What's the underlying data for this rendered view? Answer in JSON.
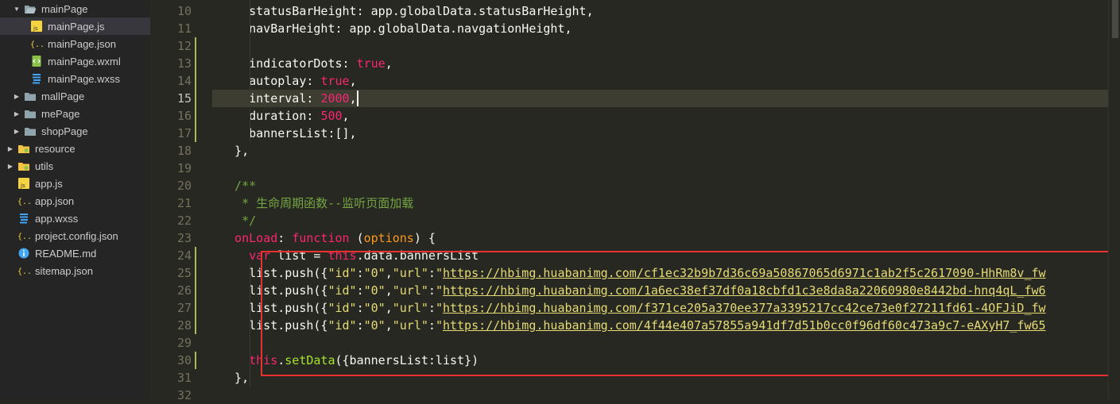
{
  "sidebar": {
    "items": [
      {
        "label": "mainPage",
        "type": "folder",
        "open": true,
        "indent": 0
      },
      {
        "label": "mainPage.js",
        "type": "js",
        "indent": 1,
        "selected": true
      },
      {
        "label": "mainPage.json",
        "type": "json",
        "indent": 1
      },
      {
        "label": "mainPage.wxml",
        "type": "wxml",
        "indent": 1
      },
      {
        "label": "mainPage.wxss",
        "type": "wxss",
        "indent": 1
      },
      {
        "label": "mallPage",
        "type": "folder",
        "open": false,
        "indent": 0
      },
      {
        "label": "mePage",
        "type": "folder",
        "open": false,
        "indent": 0
      },
      {
        "label": "shopPage",
        "type": "folder",
        "open": false,
        "indent": 0
      },
      {
        "label": "resource",
        "type": "folder-special",
        "open": false,
        "indent": -1
      },
      {
        "label": "utils",
        "type": "folder-special",
        "open": false,
        "indent": -1
      },
      {
        "label": "app.js",
        "type": "js",
        "indent": -1
      },
      {
        "label": "app.json",
        "type": "json",
        "indent": -1
      },
      {
        "label": "app.wxss",
        "type": "wxss",
        "indent": -1
      },
      {
        "label": "project.config.json",
        "type": "json",
        "indent": -1
      },
      {
        "label": "README.md",
        "type": "info",
        "indent": -1
      },
      {
        "label": "sitemap.json",
        "type": "json",
        "indent": -1
      }
    ]
  },
  "editor": {
    "line_numbers": [
      "10",
      "11",
      "12",
      "13",
      "14",
      "15",
      "16",
      "17",
      "18",
      "19",
      "20",
      "21",
      "22",
      "23",
      "24",
      "25",
      "26",
      "27",
      "28",
      "29",
      "30",
      "31",
      "32"
    ],
    "current_line": "15",
    "lines": [
      {
        "n": "10",
        "tokens": [
          {
            "c": "t",
            "v": "    statusBarHeight: app.globalData.statusBarHeight,"
          }
        ]
      },
      {
        "n": "11",
        "tokens": [
          {
            "c": "t",
            "v": "    navBarHeight: app.globalData.navgationHeight,"
          }
        ]
      },
      {
        "n": "12",
        "tokens": []
      },
      {
        "n": "13",
        "tokens": [
          {
            "c": "t",
            "v": "    indicatorDots: "
          },
          {
            "c": "kwred",
            "v": "true"
          },
          {
            "c": "t",
            "v": ","
          }
        ]
      },
      {
        "n": "14",
        "tokens": [
          {
            "c": "t",
            "v": "    autoplay: "
          },
          {
            "c": "kwred",
            "v": "true"
          },
          {
            "c": "t",
            "v": ","
          }
        ]
      },
      {
        "n": "15",
        "tokens": [
          {
            "c": "t",
            "v": "    interval: "
          },
          {
            "c": "kwred",
            "v": "2000"
          },
          {
            "c": "t",
            "v": ","
          }
        ]
      },
      {
        "n": "16",
        "tokens": [
          {
            "c": "t",
            "v": "    duration: "
          },
          {
            "c": "kwred",
            "v": "500"
          },
          {
            "c": "t",
            "v": ","
          }
        ]
      },
      {
        "n": "17",
        "tokens": [
          {
            "c": "t",
            "v": "    bannersList:[],"
          }
        ]
      },
      {
        "n": "18",
        "tokens": [
          {
            "c": "t",
            "v": "  },"
          }
        ]
      },
      {
        "n": "19",
        "tokens": []
      },
      {
        "n": "20",
        "tokens": [
          {
            "c": "cm-green",
            "v": "  /**"
          }
        ]
      },
      {
        "n": "21",
        "tokens": [
          {
            "c": "cm-green",
            "v": "   * 生命周期函数--监听页面加载"
          }
        ]
      },
      {
        "n": "22",
        "tokens": [
          {
            "c": "cm-green",
            "v": "   */"
          }
        ]
      },
      {
        "n": "23",
        "tokens": [
          {
            "c": "kwred",
            "v": "  onLoad"
          },
          {
            "c": "t",
            "v": ": "
          },
          {
            "c": "kwred",
            "v": "function"
          },
          {
            "c": "t",
            "v": " ("
          },
          {
            "c": "prm",
            "v": "options"
          },
          {
            "c": "t",
            "v": ") {"
          }
        ]
      },
      {
        "n": "24",
        "tokens": [
          {
            "c": "kwred",
            "v": "    var"
          },
          {
            "c": "t",
            "v": " list = "
          },
          {
            "c": "kwred",
            "v": "this"
          },
          {
            "c": "t",
            "v": ".data.bannersList"
          }
        ]
      },
      {
        "n": "25",
        "tokens": [
          {
            "c": "t",
            "v": "    list.push({"
          },
          {
            "c": "str",
            "v": "\"id\""
          },
          {
            "c": "t",
            "v": ":"
          },
          {
            "c": "str",
            "v": "\"0\""
          },
          {
            "c": "t",
            "v": ","
          },
          {
            "c": "str",
            "v": "\"url\""
          },
          {
            "c": "t",
            "v": ":"
          },
          {
            "c": "str",
            "v": "\""
          },
          {
            "c": "url",
            "v": "https://hbimg.huabanimg.com/cf1ec32b9b7d36c69a50867065d6971c1ab2f5c2617090-HhRm8v_fw"
          }
        ]
      },
      {
        "n": "26",
        "tokens": [
          {
            "c": "t",
            "v": "    list.push({"
          },
          {
            "c": "str",
            "v": "\"id\""
          },
          {
            "c": "t",
            "v": ":"
          },
          {
            "c": "str",
            "v": "\"0\""
          },
          {
            "c": "t",
            "v": ","
          },
          {
            "c": "str",
            "v": "\"url\""
          },
          {
            "c": "t",
            "v": ":"
          },
          {
            "c": "str",
            "v": "\""
          },
          {
            "c": "url",
            "v": "https://hbimg.huabanimg.com/1a6ec38ef37df0a18cbfd1c3e8da8a22060980e8442bd-hnq4qL_fw6"
          }
        ]
      },
      {
        "n": "27",
        "tokens": [
          {
            "c": "t",
            "v": "    list.push({"
          },
          {
            "c": "str",
            "v": "\"id\""
          },
          {
            "c": "t",
            "v": ":"
          },
          {
            "c": "str",
            "v": "\"0\""
          },
          {
            "c": "t",
            "v": ","
          },
          {
            "c": "str",
            "v": "\"url\""
          },
          {
            "c": "t",
            "v": ":"
          },
          {
            "c": "str",
            "v": "\""
          },
          {
            "c": "url",
            "v": "https://hbimg.huabanimg.com/f371ce205a370ee377a3395217cc42ce73e0f27211fd61-4OFJiD_fw"
          }
        ]
      },
      {
        "n": "28",
        "tokens": [
          {
            "c": "t",
            "v": "    list.push({"
          },
          {
            "c": "str",
            "v": "\"id\""
          },
          {
            "c": "t",
            "v": ":"
          },
          {
            "c": "str",
            "v": "\"0\""
          },
          {
            "c": "t",
            "v": ","
          },
          {
            "c": "str",
            "v": "\"url\""
          },
          {
            "c": "t",
            "v": ":"
          },
          {
            "c": "str",
            "v": "\""
          },
          {
            "c": "url",
            "v": "https://hbimg.huabanimg.com/4f44e407a57855a941df7d51b0cc0f96df60c473a9c7-eAXyH7_fw65"
          }
        ]
      },
      {
        "n": "29",
        "tokens": []
      },
      {
        "n": "30",
        "tokens": [
          {
            "c": "kwred",
            "v": "    this"
          },
          {
            "c": "t",
            "v": "."
          },
          {
            "c": "fnm",
            "v": "setData"
          },
          {
            "c": "t",
            "v": "({bannersList:list})"
          }
        ]
      },
      {
        "n": "31",
        "tokens": [
          {
            "c": "t",
            "v": "  },"
          }
        ]
      },
      {
        "n": "32",
        "tokens": []
      }
    ]
  },
  "colors": {
    "background": "#272822",
    "sidebar_bg": "#252526",
    "highlight_box": "#e8322f",
    "modified_marker": "#a6bc5b"
  }
}
